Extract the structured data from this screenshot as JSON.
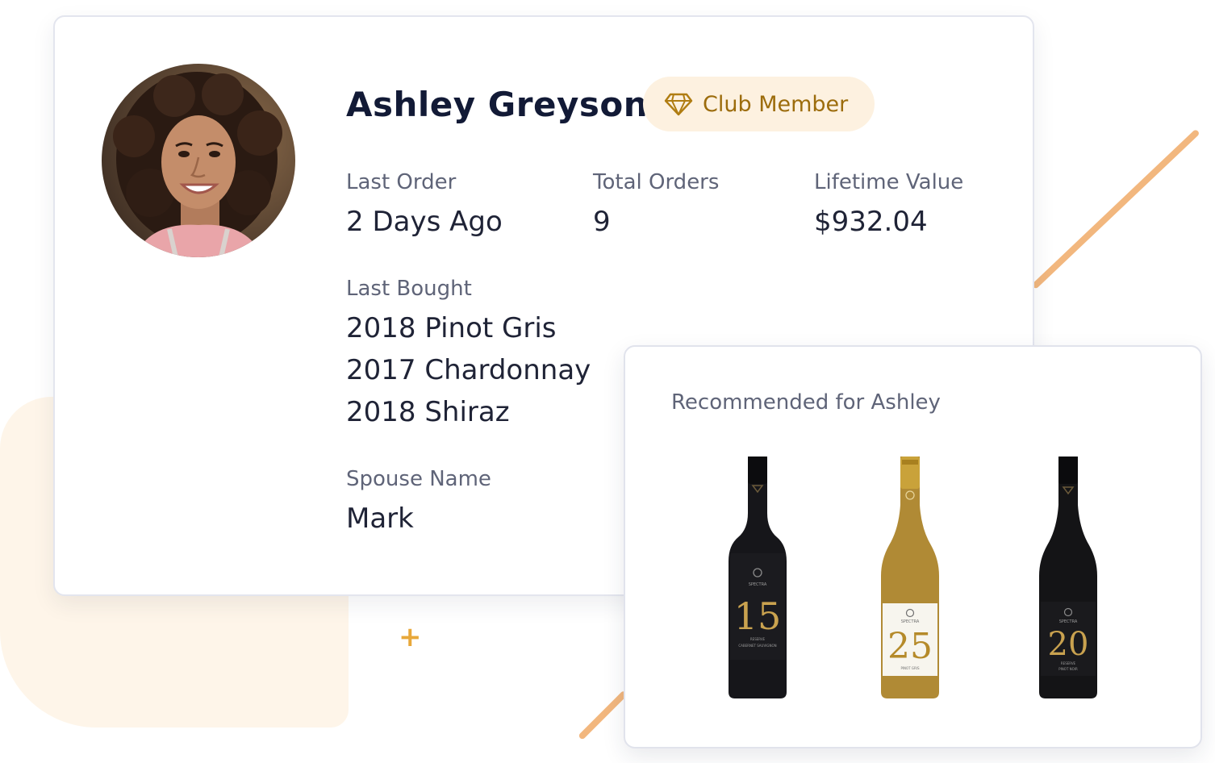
{
  "customer": {
    "name": "Ashley Greyson",
    "membership_badge": "Club Member",
    "badge_icon": "diamond-icon",
    "accent_color": "#f2b77e",
    "badge_text_color": "#9c6c0c",
    "badge_bg_color": "#fdf1e0"
  },
  "stats": {
    "last_order_label": "Last Order",
    "last_order_value": "2 Days Ago",
    "total_orders_label": "Total Orders",
    "total_orders_value": "9",
    "lifetime_value_label": "Lifetime Value",
    "lifetime_value_value": "$932.04"
  },
  "last_bought": {
    "label": "Last Bought",
    "items": [
      "2018 Pinot Gris",
      "2017 Chardonnay",
      "2018 Shiraz"
    ]
  },
  "spouse": {
    "label": "Spouse Name",
    "value": "Mark"
  },
  "recommendations": {
    "title": "Recommended for Ashley",
    "bottles": [
      {
        "vintage": "15",
        "brand": "SPECTRA",
        "line1": "RESERVE",
        "line2": "CABERNET SAUVIGNON",
        "glass_color": "#16161a",
        "label_color": "#1b1b1f",
        "vintage_color": "#c9a24f"
      },
      {
        "vintage": "25",
        "brand": "SPECTRA",
        "line1": "PINOT GRIS",
        "line2": "",
        "glass_color": "#b08a35",
        "label_color": "#f7f5ee",
        "vintage_color": "#b58a2a"
      },
      {
        "vintage": "20",
        "brand": "SPECTRA",
        "line1": "RESERVE",
        "line2": "PINOT NOIR",
        "glass_color": "#141416",
        "label_color": "#1a1a1d",
        "vintage_color": "#c9a24f"
      }
    ]
  }
}
